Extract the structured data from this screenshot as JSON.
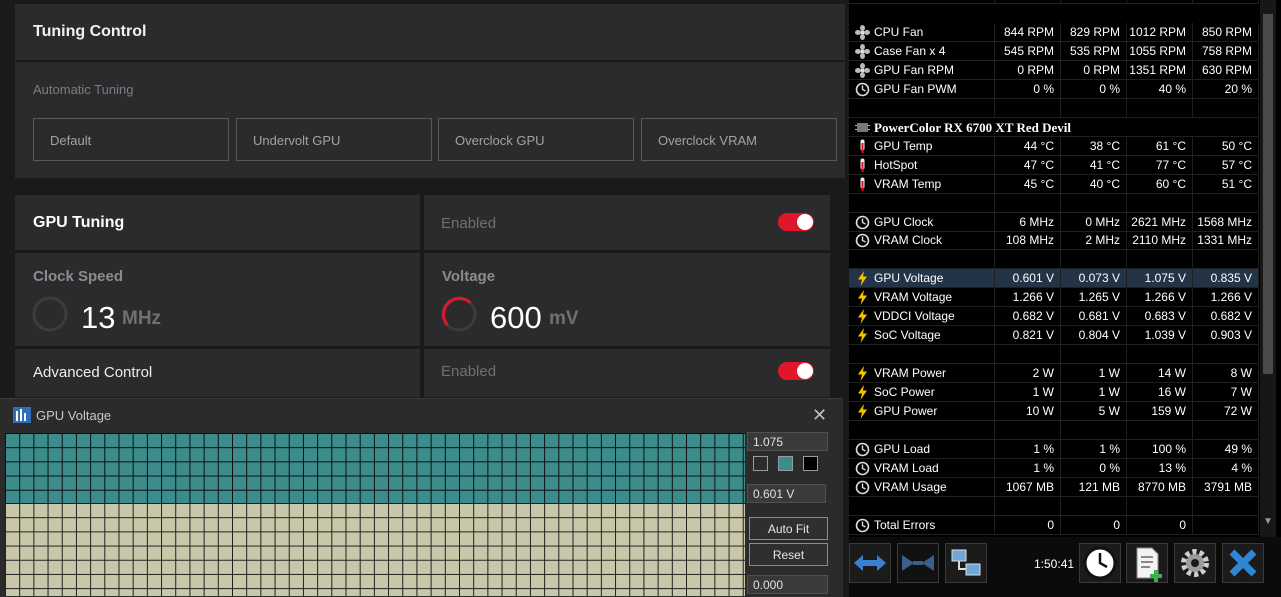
{
  "tuning": {
    "title": "Tuning Control",
    "auto_label": "Automatic Tuning",
    "presets": [
      "Default",
      "Undervolt GPU",
      "Overclock GPU",
      "Overclock VRAM"
    ],
    "gpu_tuning": {
      "title": "GPU Tuning",
      "status": "Enabled"
    },
    "clock": {
      "label": "Clock Speed",
      "value": "13",
      "unit": "MHz"
    },
    "voltage": {
      "label": "Voltage",
      "value": "600",
      "unit": "mV"
    },
    "advanced": {
      "title": "Advanced Control",
      "status": "Enabled"
    },
    "accent_color": "#e0162b"
  },
  "graph_window": {
    "title": "GPU Voltage",
    "max_value": "1.075",
    "current_value": "0.601 V",
    "min_value": "0.000",
    "auto_fit": "Auto Fit",
    "reset": "Reset",
    "upper_color": "#3b8c8b",
    "lower_color": "#c8c7aa"
  },
  "sensors": {
    "rows": [
      {
        "icon": "fan",
        "name": "CPU Fan",
        "cur": "844 RPM",
        "min": "829 RPM",
        "max": "1012 RPM",
        "avg": "850 RPM"
      },
      {
        "icon": "fan",
        "name": "Case Fan x 4",
        "cur": "545 RPM",
        "min": "535 RPM",
        "max": "1055 RPM",
        "avg": "758 RPM"
      },
      {
        "icon": "fan",
        "name": "GPU Fan RPM",
        "cur": "0 RPM",
        "min": "0 RPM",
        "max": "1351 RPM",
        "avg": "630 RPM"
      },
      {
        "icon": "clock",
        "name": "GPU Fan PWM",
        "cur": "0 %",
        "min": "0 %",
        "max": "40 %",
        "avg": "20 %"
      },
      {
        "icon": "",
        "name": "",
        "cur": "",
        "min": "",
        "max": "",
        "avg": ""
      },
      {
        "icon": "chip",
        "name": "PowerColor RX 6700 XT Red Devil",
        "group": true
      },
      {
        "icon": "thermo",
        "name": "GPU Temp",
        "cur": "44 °C",
        "min": "38 °C",
        "max": "61 °C",
        "avg": "50 °C"
      },
      {
        "icon": "thermo",
        "name": "HotSpot",
        "cur": "47 °C",
        "min": "41 °C",
        "max": "77 °C",
        "avg": "57 °C"
      },
      {
        "icon": "thermo",
        "name": "VRAM Temp",
        "cur": "45 °C",
        "min": "40 °C",
        "max": "60 °C",
        "avg": "51 °C"
      },
      {
        "icon": "",
        "name": "",
        "cur": "",
        "min": "",
        "max": "",
        "avg": ""
      },
      {
        "icon": "clock",
        "name": "GPU Clock",
        "cur": "6 MHz",
        "min": "0 MHz",
        "max": "2621 MHz",
        "avg": "1568 MHz"
      },
      {
        "icon": "clock",
        "name": "VRAM Clock",
        "cur": "108 MHz",
        "min": "2 MHz",
        "max": "2110 MHz",
        "avg": "1331 MHz"
      },
      {
        "icon": "",
        "name": "",
        "cur": "",
        "min": "",
        "max": "",
        "avg": ""
      },
      {
        "icon": "bolt",
        "name": "GPU Voltage",
        "cur": "0.601 V",
        "min": "0.073 V",
        "max": "1.075 V",
        "avg": "0.835 V",
        "highlight": true
      },
      {
        "icon": "bolt",
        "name": "VRAM Voltage",
        "cur": "1.266 V",
        "min": "1.265 V",
        "max": "1.266 V",
        "avg": "1.266 V"
      },
      {
        "icon": "bolt",
        "name": "VDDCI Voltage",
        "cur": "0.682 V",
        "min": "0.681 V",
        "max": "0.683 V",
        "avg": "0.682 V"
      },
      {
        "icon": "bolt",
        "name": "SoC Voltage",
        "cur": "0.821 V",
        "min": "0.804 V",
        "max": "1.039 V",
        "avg": "0.903 V"
      },
      {
        "icon": "",
        "name": "",
        "cur": "",
        "min": "",
        "max": "",
        "avg": ""
      },
      {
        "icon": "bolt",
        "name": "VRAM Power",
        "cur": "2 W",
        "min": "1 W",
        "max": "14 W",
        "avg": "8 W"
      },
      {
        "icon": "bolt",
        "name": "SoC Power",
        "cur": "1 W",
        "min": "1 W",
        "max": "16 W",
        "avg": "7 W"
      },
      {
        "icon": "bolt",
        "name": "GPU Power",
        "cur": "10 W",
        "min": "5 W",
        "max": "159 W",
        "avg": "72 W"
      },
      {
        "icon": "",
        "name": "",
        "cur": "",
        "min": "",
        "max": "",
        "avg": ""
      },
      {
        "icon": "clock",
        "name": "GPU Load",
        "cur": "1 %",
        "min": "1 %",
        "max": "100 %",
        "avg": "49 %"
      },
      {
        "icon": "clock",
        "name": "VRAM Load",
        "cur": "1 %",
        "min": "0 %",
        "max": "13 %",
        "avg": "4 %"
      },
      {
        "icon": "clock",
        "name": "VRAM Usage",
        "cur": "1067 MB",
        "min": "121 MB",
        "max": "8770 MB",
        "avg": "3791 MB"
      },
      {
        "icon": "",
        "name": "",
        "cur": "",
        "min": "",
        "max": "",
        "avg": ""
      },
      {
        "icon": "clock",
        "name": "Total Errors",
        "cur": "0",
        "min": "0",
        "max": "0",
        "avg": ""
      }
    ],
    "bolt_color": "#f5c400",
    "thermo_color": "#e0162b",
    "highlight_color": "#243447"
  },
  "toolbar": {
    "time": "1:50:41",
    "buttons": [
      "arrows-left-right-icon",
      "arrows-collapse-icon",
      "network-icon",
      "clock-icon",
      "report-icon",
      "gear-icon",
      "close-icon"
    ]
  }
}
